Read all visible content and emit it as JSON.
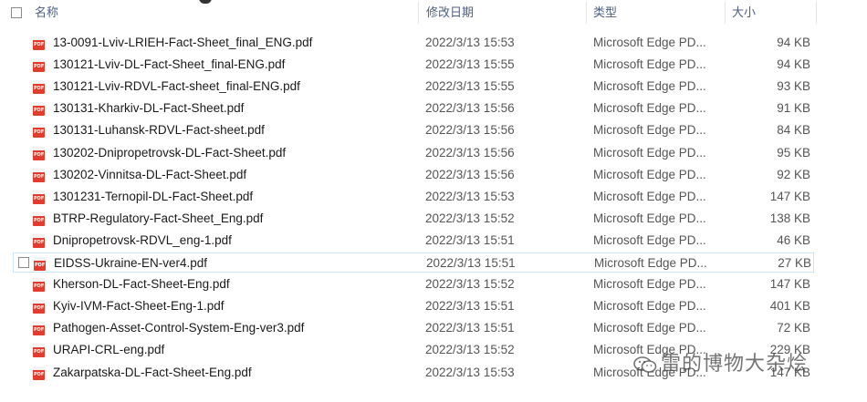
{
  "header": {
    "name": "名称",
    "date": "修改日期",
    "type": "类型",
    "size": "大小"
  },
  "icon_label": "PDF",
  "files": [
    {
      "name": "13-0091-Lviv-LRIEH-Fact-Sheet_final_ENG.pdf",
      "date": "2022/3/13 15:53",
      "type": "Microsoft Edge PD...",
      "size": "94 KB"
    },
    {
      "name": "130121-Lviv-DL-Fact-Sheet_final-ENG.pdf",
      "date": "2022/3/13 15:55",
      "type": "Microsoft Edge PD...",
      "size": "94 KB"
    },
    {
      "name": "130121-Lviv-RDVL-Fact-sheet_final-ENG.pdf",
      "date": "2022/3/13 15:55",
      "type": "Microsoft Edge PD...",
      "size": "93 KB"
    },
    {
      "name": "130131-Kharkiv-DL-Fact-Sheet.pdf",
      "date": "2022/3/13 15:56",
      "type": "Microsoft Edge PD...",
      "size": "91 KB"
    },
    {
      "name": "130131-Luhansk-RDVL-Fact-sheet.pdf",
      "date": "2022/3/13 15:56",
      "type": "Microsoft Edge PD...",
      "size": "84 KB"
    },
    {
      "name": "130202-Dnipropetrovsk-DL-Fact-Sheet.pdf",
      "date": "2022/3/13 15:56",
      "type": "Microsoft Edge PD...",
      "size": "95 KB"
    },
    {
      "name": "130202-Vinnitsa-DL-Fact-Sheet.pdf",
      "date": "2022/3/13 15:56",
      "type": "Microsoft Edge PD...",
      "size": "92 KB"
    },
    {
      "name": "1301231-Ternopil-DL-Fact-Sheet.pdf",
      "date": "2022/3/13 15:53",
      "type": "Microsoft Edge PD...",
      "size": "147 KB"
    },
    {
      "name": "BTRP-Regulatory-Fact-Sheet_Eng.pdf",
      "date": "2022/3/13 15:52",
      "type": "Microsoft Edge PD...",
      "size": "138 KB"
    },
    {
      "name": "Dnipropetrovsk-RDVL_eng-1.pdf",
      "date": "2022/3/13 15:51",
      "type": "Microsoft Edge PD...",
      "size": "46 KB"
    },
    {
      "name": "EIDSS-Ukraine-EN-ver4.pdf",
      "date": "2022/3/13 15:51",
      "type": "Microsoft Edge PD...",
      "size": "27 KB",
      "hovered": true
    },
    {
      "name": "Kherson-DL-Fact-Sheet-Eng.pdf",
      "date": "2022/3/13 15:52",
      "type": "Microsoft Edge PD...",
      "size": "147 KB"
    },
    {
      "name": "Kyiv-IVM-Fact-Sheet-Eng-1.pdf",
      "date": "2022/3/13 15:51",
      "type": "Microsoft Edge PD...",
      "size": "401 KB"
    },
    {
      "name": "Pathogen-Asset-Control-System-Eng-ver3.pdf",
      "date": "2022/3/13 15:51",
      "type": "Microsoft Edge PD...",
      "size": "72 KB"
    },
    {
      "name": "URAPI-CRL-eng.pdf",
      "date": "2022/3/13 15:52",
      "type": "Microsoft Edge PD...",
      "size": "229 KB"
    },
    {
      "name": "Zakarpatska-DL-Fact-Sheet-Eng.pdf",
      "date": "2022/3/13 15:53",
      "type": "Microsoft Edge PD...",
      "size": "147 KB"
    }
  ],
  "watermark": {
    "text": "雷的博物大杂烩",
    "icon": "wechat-icon"
  },
  "colors": {
    "header_text": "#4d6082",
    "pdf_icon": "#e23c2f",
    "hover_border": "#cde6f7"
  }
}
